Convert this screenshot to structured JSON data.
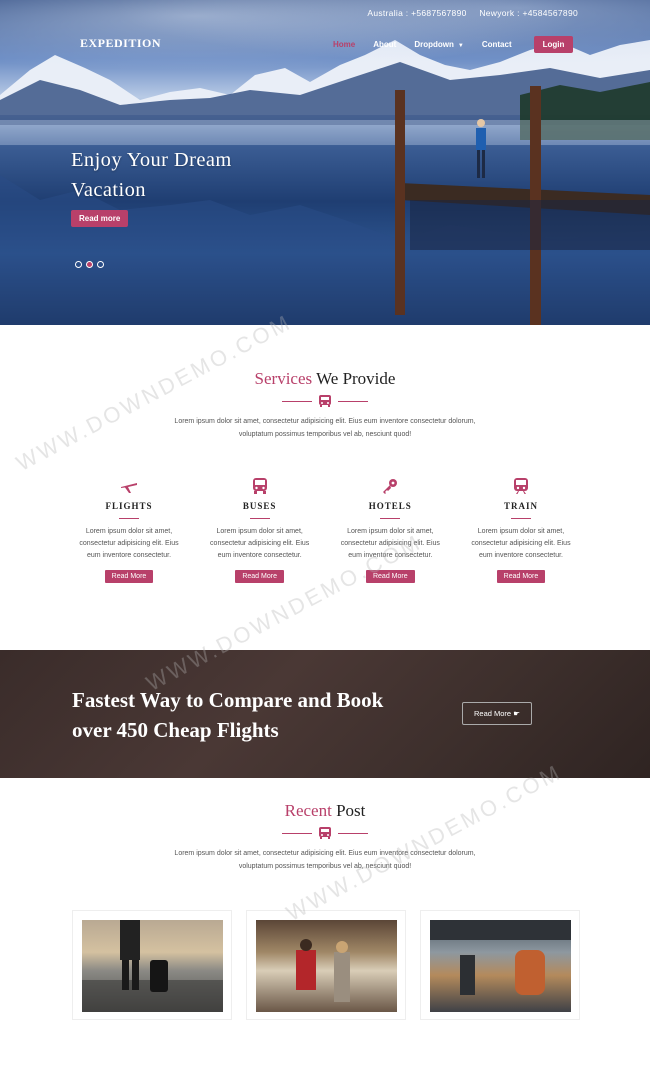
{
  "topbar": {
    "australia": "Australia : +5687567890",
    "newyork": "Newyork : +4584567890"
  },
  "brand": "EXPEDITION",
  "nav": {
    "home": "Home",
    "about": "About",
    "dropdown": "Dropdown",
    "contact": "Contact",
    "login": "Login"
  },
  "hero": {
    "title_line1": "Enjoy Your Dream",
    "title_line2": "Vacation",
    "button": "Read more"
  },
  "services": {
    "title_accent": "Services",
    "title_rest": " We Provide",
    "desc_line1": "Lorem ipsum dolor sit amet, consectetur adipisicing elit. Eius eum inventore consectetur dolorum,",
    "desc_line2": "voluptatum possimus temporibus vel ab, nesciunt quod!",
    "items": [
      {
        "name": "FLIGHTS",
        "icon": "plane-icon",
        "text1": "Lorem ipsum dolor sit amet,",
        "text2": "consectetur adipisicing elit. Eius",
        "text3": "eum inventore consectetur.",
        "button": "Read More"
      },
      {
        "name": "BUSES",
        "icon": "bus-icon",
        "text1": "Lorem ipsum dolor sit amet,",
        "text2": "consectetur adipisicing elit. Eius",
        "text3": "eum inventore consectetur.",
        "button": "Read More"
      },
      {
        "name": "HOTELS",
        "icon": "key-icon",
        "text1": "Lorem ipsum dolor sit amet,",
        "text2": "consectetur adipisicing elit. Eius",
        "text3": "eum inventore consectetur.",
        "button": "Read More"
      },
      {
        "name": "TRAIN",
        "icon": "train-icon",
        "text1": "Lorem ipsum dolor sit amet,",
        "text2": "consectetur adipisicing elit. Eius",
        "text3": "eum inventore consectetur.",
        "button": "Read More"
      }
    ]
  },
  "cta": {
    "line1": "Fastest Way to Compare and Book",
    "line2": "over 450 Cheap Flights",
    "button": "Read More"
  },
  "recent": {
    "title_accent": "Recent",
    "title_rest": " Post",
    "desc_line1": "Lorem ipsum dolor sit amet, consectetur adipisicing elit. Eius eum inventore consectetur dolorum,",
    "desc_line2": "voluptatum possimus temporibus vel ab, nesciunt quod!"
  },
  "colors": {
    "accent": "#b8406a",
    "cta_bg": "#3d2f2c"
  }
}
